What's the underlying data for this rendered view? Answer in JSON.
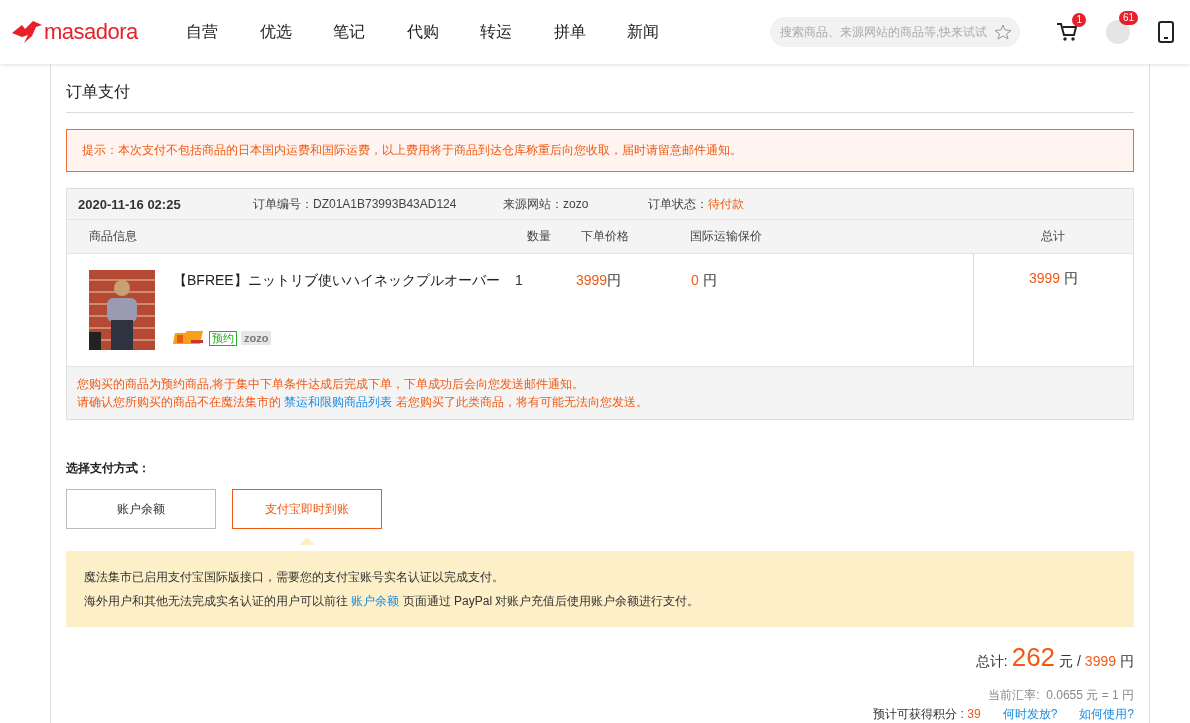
{
  "header": {
    "logo_text": "masadora",
    "nav": [
      {
        "label": "自营"
      },
      {
        "label": "优选"
      },
      {
        "label": "笔记"
      },
      {
        "label": "代购"
      },
      {
        "label": "转运"
      },
      {
        "label": "拼单"
      },
      {
        "label": "新闻"
      }
    ],
    "search": {
      "placeholder": "搜索商品、来源网站的商品等,快来试试"
    },
    "cart_badge": "1",
    "message_badge": "61"
  },
  "page_title": "订单支付",
  "notice": "提示：本次支付不包括商品的日本国内运费和国际运费，以上费用将于商品到达仓库称重后向您收取，届时请留意邮件通知。",
  "order": {
    "date": "2020-11-16 02:25",
    "order_no_label": "订单编号：",
    "order_no": "DZ01A1B73993B43AD124",
    "source_label": "来源网站：",
    "source": "zozo",
    "status_label": "订单状态：",
    "status": "待付款",
    "columns": [
      "商品信息",
      "数量",
      "下单价格",
      "国际运输保价",
      "总计"
    ],
    "item": {
      "name": "【BFREE】ニットリブ使いハイネックプルオーバー",
      "qty": "1",
      "price": "3999",
      "price_unit": "円",
      "insurance": "0",
      "insurance_unit": "円",
      "total": "3999",
      "total_unit": "円",
      "tags": [
        {
          "kind": "plus-logo"
        },
        {
          "kind": "tag",
          "text": "预约"
        },
        {
          "kind": "source",
          "text": "zozo"
        }
      ]
    },
    "note_1": "您购买的商品为预约商品,将于集中下单条件达成后完成下单，下单成功后会向您发送邮件通知。",
    "note_2_before": "请确认您所购买的商品不在魔法集市的",
    "note_2_link": "禁运和限购商品列表",
    "note_2_after": "若您购买了此类商品，将有可能无法向您发送。"
  },
  "payment": {
    "label": "选择支付方式：",
    "methods": [
      {
        "label": "账户余额",
        "selected": false
      },
      {
        "label": "支付宝即时到账",
        "selected": true
      }
    ],
    "info_1": "魔法集市已启用支付宝国际版接口，需要您的支付宝账号实名认证以完成支付。",
    "info_2_before": "海外用户和其他无法完成实名认证的用户可以前往",
    "info_2_link": "账户余额",
    "info_2_after": "页面通过 PayPal 对账户充值后使用账户余额进行支付。"
  },
  "summary": {
    "total_label": "总计:",
    "cny": "262",
    "cny_unit": "元",
    "separator": "/",
    "jpy": "3999",
    "jpy_unit": "円",
    "rate_label": "当前汇率:",
    "rate": "0.0655 元 = 1 円",
    "points_label": "预计可获得积分 :",
    "points": "39",
    "links": [
      "何时发放?",
      "如何使用?"
    ]
  }
}
